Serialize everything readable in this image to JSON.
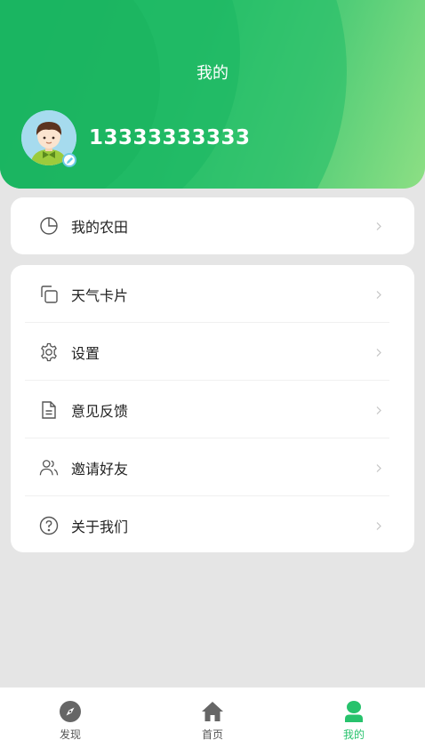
{
  "header": {
    "title": "我的",
    "phone": "13333333333"
  },
  "menu_primary": [
    {
      "label": "我的农田",
      "icon": "pie-chart-icon"
    }
  ],
  "menu_secondary": [
    {
      "label": "天气卡片",
      "icon": "copy-icon"
    },
    {
      "label": "设置",
      "icon": "gear-icon"
    },
    {
      "label": "意见反馈",
      "icon": "document-icon"
    },
    {
      "label": "邀请好友",
      "icon": "users-icon"
    },
    {
      "label": "关于我们",
      "icon": "question-icon"
    }
  ],
  "tabbar": [
    {
      "label": "发现",
      "icon": "compass-icon",
      "active": false
    },
    {
      "label": "首页",
      "icon": "home-icon",
      "active": false
    },
    {
      "label": "我的",
      "icon": "user-icon",
      "active": true
    }
  ],
  "colors": {
    "accent": "#27c26c",
    "header_start": "#1cb865",
    "header_end": "#8ddf84",
    "background": "#e5e5e5"
  }
}
